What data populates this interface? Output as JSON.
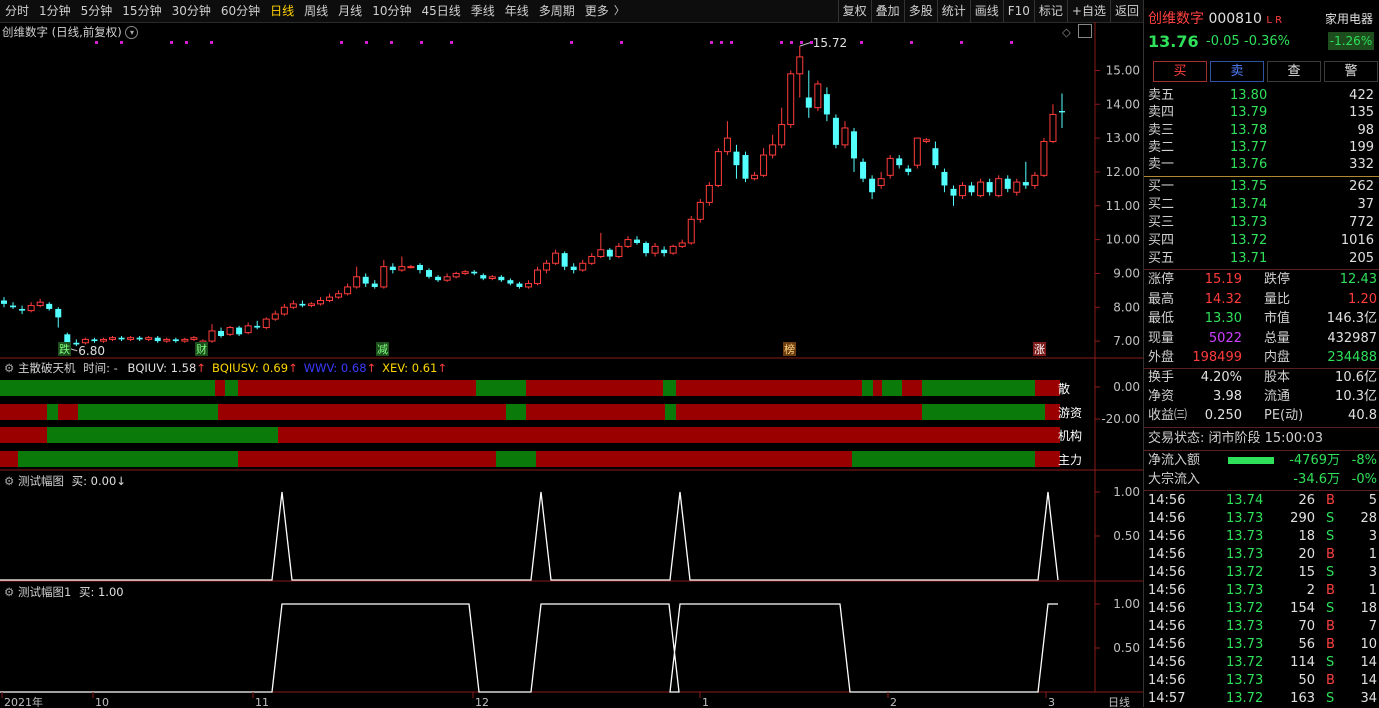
{
  "toolbar": {
    "periods": [
      "分时",
      "1分钟",
      "5分钟",
      "15分钟",
      "30分钟",
      "60分钟",
      "日线",
      "周线",
      "月线",
      "10分钟",
      "45日线",
      "季线",
      "年线",
      "多周期",
      "更多"
    ],
    "active": "日线",
    "right_buttons": [
      "复权",
      "叠加",
      "多股",
      "统计",
      "画线",
      "F10",
      "标记",
      "+自选",
      "返回"
    ]
  },
  "main_chart": {
    "title": "创维数字 (日线,前复权)",
    "price_ticks": [
      "15.00",
      "14.00",
      "13.00",
      "12.00",
      "11.00",
      "10.00",
      "9.00",
      "8.00",
      "7.00"
    ],
    "high_label": "15.72",
    "low_label": "6.80",
    "event_tags": [
      "跌",
      "财",
      "减",
      "榜",
      "涨"
    ]
  },
  "indicator1": {
    "name": "主散破天机",
    "time_label": "时间: -",
    "values": [
      {
        "name": "BQIUV",
        "text": "BQIUV: 1.58",
        "color": "#e0e0e0"
      },
      {
        "name": "BQIUSV",
        "text": "BQIUSV: 0.69",
        "color": "#ffd700"
      },
      {
        "name": "WWV",
        "text": "WWV: 0.68",
        "color": "#3a3aff"
      },
      {
        "name": "XEV",
        "text": "XEV: 0.61",
        "color": "#ffd700"
      }
    ],
    "ticks": [
      "0.00",
      "-20.00"
    ],
    "band_labels": [
      "散",
      "游资",
      "机构",
      "主力"
    ]
  },
  "indicator2": {
    "title": "测试幅图",
    "value_text": "买: 0.00",
    "ticks": [
      "1.00",
      "0.50"
    ]
  },
  "indicator3": {
    "title": "测试幅图1",
    "value_text": "买: 1.00",
    "ticks": [
      "1.00",
      "0.50"
    ]
  },
  "x_axis": {
    "labels": [
      "2021年",
      "10",
      "11",
      "12",
      "1",
      "2",
      "3"
    ],
    "period_label": "日线"
  },
  "quote": {
    "name": "创维数字",
    "code": "000810",
    "flags": "L R",
    "sector": "家用电器",
    "sector_change": "-1.26%",
    "price": "13.76",
    "change": "-0.05",
    "change_pct": "-0.36%",
    "buttons": [
      "买",
      "卖",
      "查",
      "警"
    ],
    "sells": [
      {
        "label": "卖五",
        "price": "13.80",
        "vol": "422"
      },
      {
        "label": "卖四",
        "price": "13.79",
        "vol": "135"
      },
      {
        "label": "卖三",
        "price": "13.78",
        "vol": "98"
      },
      {
        "label": "卖二",
        "price": "13.77",
        "vol": "199"
      },
      {
        "label": "卖一",
        "price": "13.76",
        "vol": "332"
      }
    ],
    "buys": [
      {
        "label": "买一",
        "price": "13.75",
        "vol": "262"
      },
      {
        "label": "买二",
        "price": "13.74",
        "vol": "37"
      },
      {
        "label": "买三",
        "price": "13.73",
        "vol": "772"
      },
      {
        "label": "买四",
        "price": "13.72",
        "vol": "1016"
      },
      {
        "label": "买五",
        "price": "13.71",
        "vol": "205"
      }
    ],
    "stats": [
      {
        "l1": "涨停",
        "v1": "15.19",
        "c1": "#ff3c3c",
        "l2": "跌停",
        "v2": "12.43",
        "c2": "#2fe05a"
      },
      {
        "l1": "最高",
        "v1": "14.32",
        "c1": "#ff3c3c",
        "l2": "量比",
        "v2": "1.20",
        "c2": "#ff3c3c"
      },
      {
        "l1": "最低",
        "v1": "13.30",
        "c1": "#2fe05a",
        "l2": "市值",
        "v2": "146.3亿",
        "c2": "#e0e0e0"
      },
      {
        "l1": "现量",
        "v1": "5022",
        "c1": "#d040ff",
        "l2": "总量",
        "v2": "432987",
        "c2": "#e0e0e0"
      },
      {
        "l1": "外盘",
        "v1": "198499",
        "c1": "#ff3c3c",
        "l2": "内盘",
        "v2": "234488",
        "c2": "#2fe05a"
      }
    ],
    "stats2": [
      {
        "l1": "换手",
        "v1": "4.20%",
        "l2": "股本",
        "v2": "10.6亿"
      },
      {
        "l1": "净资",
        "v1": "3.98",
        "l2": "流通",
        "v2": "10.3亿"
      },
      {
        "l1": "收益㈢",
        "v1": "0.250",
        "l2": "PE(动)",
        "v2": "40.8"
      }
    ],
    "trade_status": "交易状态: 闭市阶段 15:00:03",
    "net_inflow": {
      "label": "净流入额",
      "value": "-4769万",
      "pct": "-8%"
    },
    "block_inflow": {
      "label": "大宗流入",
      "value": "-34.6万",
      "pct": "-0%"
    },
    "ticks": [
      {
        "t": "14:56",
        "p": "13.74",
        "v": "26",
        "s": "B",
        "n": "5"
      },
      {
        "t": "14:56",
        "p": "13.73",
        "v": "290",
        "s": "S",
        "n": "28"
      },
      {
        "t": "14:56",
        "p": "13.73",
        "v": "18",
        "s": "S",
        "n": "3"
      },
      {
        "t": "14:56",
        "p": "13.73",
        "v": "20",
        "s": "B",
        "n": "1"
      },
      {
        "t": "14:56",
        "p": "13.72",
        "v": "15",
        "s": "S",
        "n": "3"
      },
      {
        "t": "14:56",
        "p": "13.73",
        "v": "2",
        "s": "B",
        "n": "1"
      },
      {
        "t": "14:56",
        "p": "13.72",
        "v": "154",
        "s": "S",
        "n": "18"
      },
      {
        "t": "14:56",
        "p": "13.73",
        "v": "70",
        "s": "B",
        "n": "7"
      },
      {
        "t": "14:56",
        "p": "13.73",
        "v": "56",
        "s": "B",
        "n": "10"
      },
      {
        "t": "14:56",
        "p": "13.72",
        "v": "114",
        "s": "S",
        "n": "14"
      },
      {
        "t": "14:56",
        "p": "13.73",
        "v": "50",
        "s": "B",
        "n": "14"
      },
      {
        "t": "14:57",
        "p": "13.72",
        "v": "163",
        "s": "S",
        "n": "34"
      }
    ]
  },
  "chart_data": {
    "type": "candlestick",
    "ylim": [
      6.5,
      15.9
    ],
    "candles": [
      [
        8.2,
        8.1,
        8.3,
        8.0
      ],
      [
        8.05,
        8.0,
        8.15,
        7.95
      ],
      [
        7.95,
        7.9,
        8.05,
        7.8
      ],
      [
        7.9,
        8.05,
        8.15,
        7.85
      ],
      [
        8.05,
        8.15,
        8.25,
        8.0
      ],
      [
        8.1,
        7.95,
        8.15,
        7.9
      ],
      [
        7.95,
        7.7,
        8.0,
        7.4
      ],
      [
        7.2,
        6.95,
        7.25,
        6.8
      ],
      [
        6.95,
        6.9,
        7.05,
        6.85
      ],
      [
        6.95,
        7.05,
        7.1,
        6.9
      ],
      [
        7.05,
        7.0,
        7.1,
        6.95
      ],
      [
        7.0,
        7.05,
        7.1,
        6.95
      ],
      [
        7.05,
        7.1,
        7.15,
        7.0
      ],
      [
        7.1,
        7.05,
        7.15,
        7.0
      ],
      [
        7.05,
        7.1,
        7.15,
        7.0
      ],
      [
        7.1,
        7.05,
        7.15,
        7.0
      ],
      [
        7.05,
        7.1,
        7.15,
        7.0
      ],
      [
        7.1,
        7.0,
        7.15,
        6.95
      ],
      [
        7.0,
        7.05,
        7.1,
        6.95
      ],
      [
        7.05,
        7.0,
        7.1,
        6.95
      ],
      [
        7.0,
        7.05,
        7.1,
        6.95
      ],
      [
        7.05,
        7.1,
        7.15,
        7.0
      ],
      [
        6.9,
        7.0,
        7.05,
        6.85
      ],
      [
        7.0,
        7.3,
        7.5,
        6.95
      ],
      [
        7.3,
        7.15,
        7.4,
        7.1
      ],
      [
        7.2,
        7.4,
        7.45,
        7.15
      ],
      [
        7.4,
        7.2,
        7.45,
        7.15
      ],
      [
        7.25,
        7.45,
        7.55,
        7.2
      ],
      [
        7.45,
        7.4,
        7.6,
        7.35
      ],
      [
        7.4,
        7.65,
        7.7,
        7.35
      ],
      [
        7.65,
        7.8,
        7.9,
        7.6
      ],
      [
        7.8,
        8.0,
        8.1,
        7.75
      ],
      [
        8.0,
        8.1,
        8.2,
        7.95
      ],
      [
        8.1,
        8.05,
        8.2,
        8.0
      ],
      [
        8.05,
        8.1,
        8.15,
        8.0
      ],
      [
        8.1,
        8.2,
        8.3,
        8.05
      ],
      [
        8.2,
        8.3,
        8.4,
        8.15
      ],
      [
        8.3,
        8.4,
        8.5,
        8.25
      ],
      [
        8.4,
        8.6,
        8.7,
        8.35
      ],
      [
        8.6,
        8.9,
        9.2,
        8.55
      ],
      [
        8.9,
        8.7,
        9.0,
        8.6
      ],
      [
        8.7,
        8.6,
        8.8,
        8.55
      ],
      [
        8.6,
        9.2,
        9.4,
        8.55
      ],
      [
        9.2,
        9.1,
        9.3,
        9.0
      ],
      [
        9.1,
        9.2,
        9.5,
        9.05
      ],
      [
        9.2,
        9.2,
        9.25,
        9.15
      ],
      [
        9.25,
        9.1,
        9.3,
        9.0
      ],
      [
        9.1,
        8.9,
        9.15,
        8.85
      ],
      [
        8.9,
        8.8,
        8.95,
        8.75
      ],
      [
        8.8,
        8.9,
        9.0,
        8.75
      ],
      [
        8.9,
        9.0,
        9.05,
        8.85
      ],
      [
        9.0,
        9.05,
        9.1,
        8.95
      ],
      [
        9.05,
        9.0,
        9.1,
        8.95
      ],
      [
        8.95,
        8.85,
        9.0,
        8.8
      ],
      [
        8.85,
        8.9,
        8.95,
        8.8
      ],
      [
        8.9,
        8.8,
        8.95,
        8.75
      ],
      [
        8.8,
        8.7,
        8.85,
        8.65
      ],
      [
        8.7,
        8.6,
        8.75,
        8.55
      ],
      [
        8.6,
        8.7,
        8.8,
        8.55
      ],
      [
        8.7,
        9.1,
        9.2,
        8.65
      ],
      [
        9.1,
        9.3,
        9.4,
        9.0
      ],
      [
        9.3,
        9.6,
        9.7,
        9.25
      ],
      [
        9.6,
        9.2,
        9.65,
        9.1
      ],
      [
        9.2,
        9.1,
        9.3,
        9.0
      ],
      [
        9.1,
        9.3,
        9.4,
        9.05
      ],
      [
        9.3,
        9.5,
        9.6,
        9.25
      ],
      [
        9.5,
        9.7,
        10.2,
        9.45
      ],
      [
        9.7,
        9.5,
        9.75,
        9.4
      ],
      [
        9.5,
        9.8,
        9.9,
        9.45
      ],
      [
        9.8,
        10.0,
        10.1,
        9.75
      ],
      [
        10.0,
        9.9,
        10.1,
        9.85
      ],
      [
        9.9,
        9.6,
        9.95,
        9.5
      ],
      [
        9.6,
        9.8,
        9.9,
        9.5
      ],
      [
        9.7,
        9.6,
        9.8,
        9.5
      ],
      [
        9.6,
        9.8,
        9.85,
        9.55
      ],
      [
        9.8,
        9.9,
        10.0,
        9.75
      ],
      [
        9.9,
        10.6,
        10.7,
        9.85
      ],
      [
        10.6,
        11.1,
        11.2,
        10.5
      ],
      [
        11.1,
        11.6,
        11.7,
        11.0
      ],
      [
        11.6,
        12.6,
        12.7,
        11.55
      ],
      [
        12.6,
        13.0,
        13.5,
        12.5
      ],
      [
        12.6,
        12.2,
        12.8,
        11.8
      ],
      [
        12.5,
        11.8,
        12.6,
        11.7
      ],
      [
        11.8,
        11.9,
        12.0,
        11.75
      ],
      [
        11.9,
        12.5,
        12.7,
        11.85
      ],
      [
        12.5,
        12.8,
        13.1,
        12.4
      ],
      [
        12.8,
        13.4,
        13.9,
        12.7
      ],
      [
        13.4,
        14.9,
        15.0,
        13.3
      ],
      [
        14.9,
        15.4,
        15.72,
        14.2
      ],
      [
        14.2,
        13.9,
        15.0,
        13.6
      ],
      [
        13.9,
        14.6,
        14.7,
        13.8
      ],
      [
        14.3,
        13.7,
        14.5,
        13.5
      ],
      [
        13.6,
        12.8,
        13.7,
        12.7
      ],
      [
        12.8,
        13.3,
        13.5,
        12.7
      ],
      [
        13.2,
        12.4,
        13.3,
        12.0
      ],
      [
        12.3,
        11.8,
        12.4,
        11.7
      ],
      [
        11.8,
        11.4,
        11.9,
        11.2
      ],
      [
        11.6,
        11.8,
        12.0,
        11.5
      ],
      [
        11.9,
        12.4,
        12.5,
        11.8
      ],
      [
        12.4,
        12.2,
        12.5,
        12.1
      ],
      [
        12.1,
        12.0,
        12.2,
        11.9
      ],
      [
        12.2,
        13.0,
        13.0,
        12.1
      ],
      [
        12.9,
        12.95,
        13.0,
        12.85
      ],
      [
        12.7,
        12.2,
        12.9,
        12.1
      ],
      [
        12.0,
        11.6,
        12.1,
        11.4
      ],
      [
        11.5,
        11.3,
        11.6,
        11.0
      ],
      [
        11.3,
        11.6,
        11.7,
        11.2
      ],
      [
        11.6,
        11.4,
        11.7,
        11.3
      ],
      [
        11.3,
        11.7,
        11.8,
        11.25
      ],
      [
        11.7,
        11.4,
        11.8,
        11.3
      ],
      [
        11.3,
        11.8,
        11.9,
        11.25
      ],
      [
        11.8,
        11.5,
        11.9,
        11.4
      ],
      [
        11.4,
        11.7,
        11.8,
        11.3
      ],
      [
        11.7,
        11.6,
        12.3,
        11.5
      ],
      [
        11.6,
        11.9,
        12.0,
        11.5
      ],
      [
        11.9,
        12.9,
        13.0,
        11.85
      ],
      [
        12.9,
        13.7,
        14.0,
        12.85
      ],
      [
        13.8,
        13.76,
        14.32,
        13.3
      ]
    ],
    "indicator1_bands": [
      {
        "name": "散",
        "segments": [
          [
            "g",
            0,
            215
          ],
          [
            "r",
            215,
            225
          ],
          [
            "g",
            225,
            238
          ],
          [
            "r",
            238,
            476
          ],
          [
            "g",
            476,
            526
          ],
          [
            "r",
            526,
            663
          ],
          [
            "g",
            663,
            676
          ],
          [
            "r",
            676,
            862
          ],
          [
            "g",
            862,
            873
          ],
          [
            "r",
            873,
            882
          ],
          [
            "g",
            882,
            902
          ],
          [
            "r",
            902,
            922
          ],
          [
            "g",
            922,
            1035
          ],
          [
            "r",
            1035,
            1060
          ]
        ]
      },
      {
        "name": "游资",
        "segments": [
          [
            "r",
            0,
            47
          ],
          [
            "g",
            47,
            58
          ],
          [
            "r",
            58,
            78
          ],
          [
            "g",
            78,
            218
          ],
          [
            "r",
            218,
            506
          ],
          [
            "g",
            506,
            526
          ],
          [
            "r",
            526,
            665
          ],
          [
            "g",
            665,
            676
          ],
          [
            "r",
            676,
            922
          ],
          [
            "g",
            922,
            1045
          ],
          [
            "r",
            1045,
            1060
          ]
        ]
      },
      {
        "name": "机构",
        "segments": [
          [
            "r",
            0,
            47
          ],
          [
            "g",
            47,
            278
          ],
          [
            "r",
            278,
            1060
          ]
        ]
      },
      {
        "name": "主力",
        "segments": [
          [
            "r",
            0,
            18
          ],
          [
            "g",
            18,
            238
          ],
          [
            "r",
            238,
            496
          ],
          [
            "g",
            496,
            536
          ],
          [
            "r",
            536,
            852
          ],
          [
            "g",
            852,
            1035
          ],
          [
            "r",
            1035,
            1060
          ]
        ]
      }
    ],
    "indicator2_peaks": [
      282,
      541,
      680,
      1048
    ],
    "indicator3_plateaus": [
      [
        282,
        469
      ],
      [
        541,
        669
      ],
      [
        680,
        840
      ],
      [
        1048,
        1058
      ]
    ],
    "markers": [
      95,
      120,
      170,
      185,
      210,
      340,
      365,
      390,
      420,
      450,
      570,
      620,
      710,
      720,
      730,
      780,
      790,
      800,
      810,
      860,
      910,
      960,
      1010
    ]
  }
}
